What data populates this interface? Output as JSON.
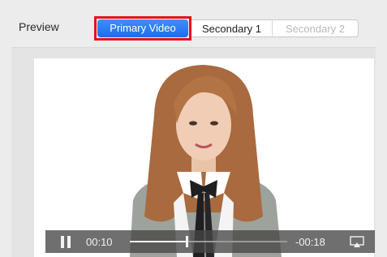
{
  "header": {
    "preview_label": "Preview"
  },
  "tabs": {
    "primary": "Primary Video",
    "secondary1": "Secondary 1",
    "secondary2": "Secondary 2",
    "selected": "primary",
    "accent_color": "#2f7df5",
    "highlight_color": "#e0141e"
  },
  "player": {
    "elapsed": "00:10",
    "remaining": "-00:18",
    "progress": 0.36,
    "state": "playing",
    "pause_icon": "pause-icon",
    "airplay_icon": "airplay-icon"
  }
}
